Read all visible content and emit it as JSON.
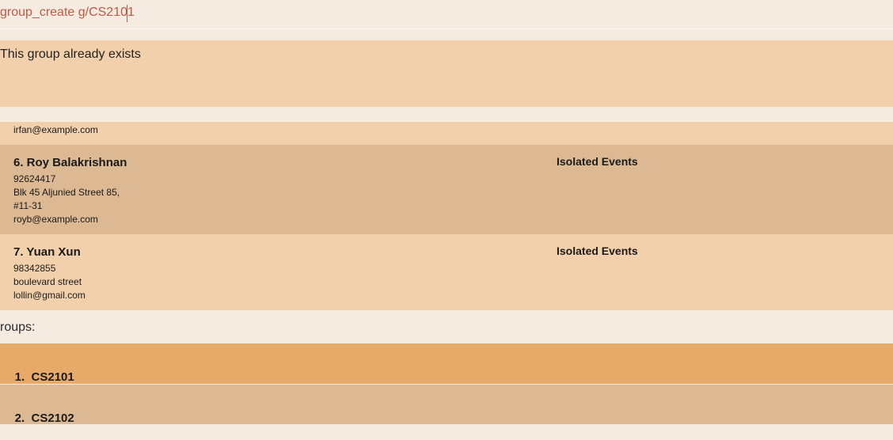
{
  "command": {
    "input_value": "group_create g/CS2101"
  },
  "result": {
    "message": "This group already exists"
  },
  "persons": [
    {
      "email": "irfan@example.com"
    },
    {
      "index_name": "6. Roy Balakrishnan",
      "phone": "92624417",
      "address_line1": "Blk 45 Aljunied Street 85,",
      "address_line2": "#11-31",
      "email": "royb@example.com",
      "group": "Isolated Events"
    },
    {
      "index_name": "7. Yuan Xun",
      "phone": "98342855",
      "address": "boulevard street",
      "email": "lollin@gmail.com",
      "group": "Isolated Events"
    }
  ],
  "groups": {
    "label": "roups:",
    "items": [
      {
        "index": "1.",
        "name": "CS2101"
      },
      {
        "index": "2.",
        "name": "CS2102"
      }
    ]
  },
  "colors": {
    "command_text": "#c05a44",
    "card_light": "#f2d0ac",
    "card_dark": "#dcb993",
    "group_selected": "#e8aa68",
    "background": "#f5ebe1"
  }
}
